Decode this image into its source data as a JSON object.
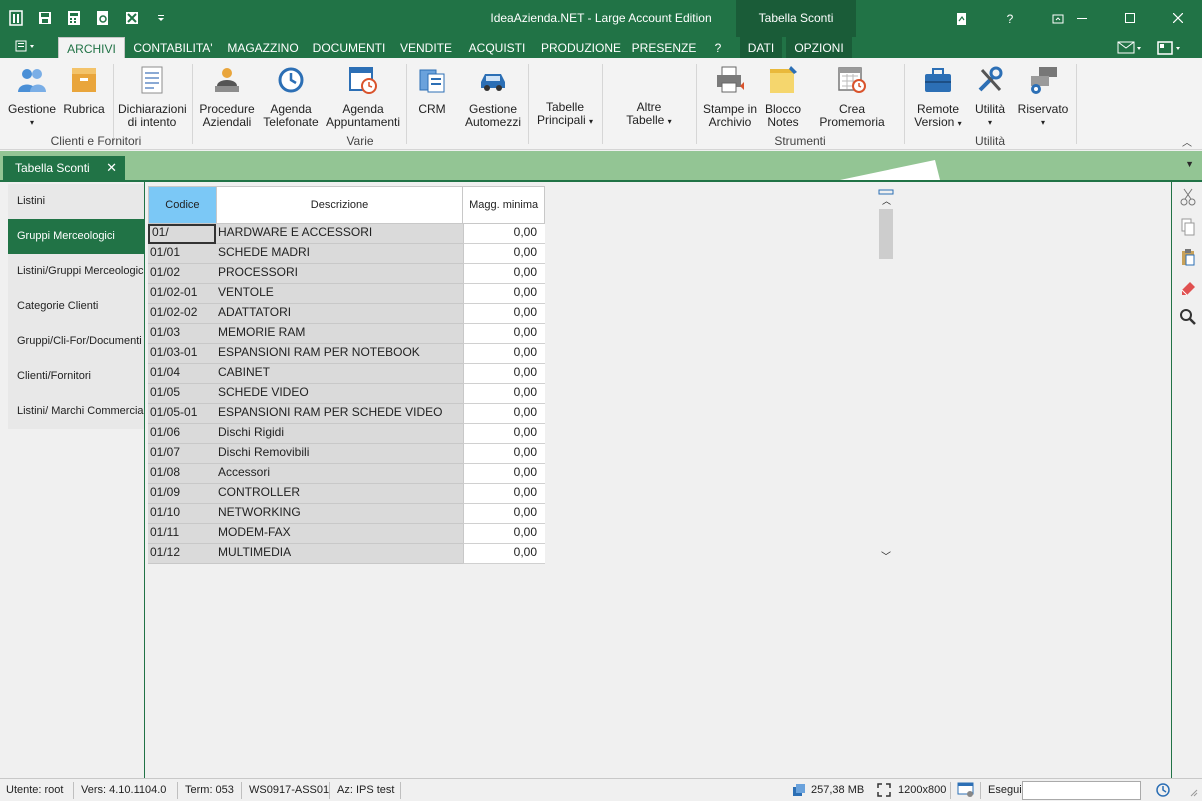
{
  "window": {
    "title": "IdeaAzienda.NET - Large Account Edition",
    "context_title": "Tabella Sconti",
    "help_label": "?"
  },
  "tabs": [
    {
      "label": "ARCHIVI",
      "active": true
    },
    {
      "label": "CONTABILITA'"
    },
    {
      "label": "MAGAZZINO"
    },
    {
      "label": "DOCUMENTI"
    },
    {
      "label": "VENDITE"
    },
    {
      "label": "ACQUISTI"
    },
    {
      "label": "PRODUZIONE"
    },
    {
      "label": "PRESENZE"
    },
    {
      "label": "?"
    },
    {
      "label": "DATI"
    },
    {
      "label": "OPZIONI"
    }
  ],
  "ribbon": {
    "gestione": "Gestione",
    "rubrica": "Rubrica",
    "dichiarazioni_1": "Dichiarazioni",
    "dichiarazioni_2": "di intento",
    "group_clienti": "Clienti e Fornitori",
    "procedure_1": "Procedure",
    "procedure_2": "Aziendali",
    "agenda_tel_1": "Agenda",
    "agenda_tel_2": "Telefonate",
    "agenda_app_1": "Agenda",
    "agenda_app_2": "Appuntamenti",
    "group_varie": "Varie",
    "crm": "CRM",
    "automezzi_1": "Gestione",
    "automezzi_2": "Automezzi",
    "tabelle_1": "Tabelle",
    "tabelle_2": "Principali",
    "altre_1": "Altre",
    "altre_2": "Tabelle",
    "stampe_1": "Stampe in",
    "stampe_2": "Archivio",
    "blocco_1": "Blocco",
    "blocco_2": "Notes",
    "promemoria": "Crea Promemoria",
    "group_strumenti": "Strumenti",
    "remote_1": "Remote",
    "remote_2": "Version",
    "utilita": "Utilità",
    "riservato": "Riservato",
    "group_utilita": "Utilità"
  },
  "doc_tab": {
    "label": "Tabella Sconti",
    "close": "✕"
  },
  "nav": [
    "Listini",
    "Gruppi Merceologici",
    "Listini/Gruppi Merceologici",
    "Categorie Clienti",
    "Gruppi/Cli-For/Documenti",
    "Clienti/Fornitori",
    "Listini/ Marchi Commerciali"
  ],
  "grid": {
    "headers": {
      "codice": "Codice",
      "descrizione": "Descrizione",
      "magg": "Magg. minima"
    },
    "rows": [
      {
        "codice": "01/",
        "descrizione": "HARDWARE E ACCESSORI",
        "magg": "0,00"
      },
      {
        "codice": "01/01",
        "descrizione": "SCHEDE MADRI",
        "magg": "0,00"
      },
      {
        "codice": "01/02",
        "descrizione": "PROCESSORI",
        "magg": "0,00"
      },
      {
        "codice": "01/02-01",
        "descrizione": "VENTOLE",
        "magg": "0,00"
      },
      {
        "codice": "01/02-02",
        "descrizione": "ADATTATORI",
        "magg": "0,00"
      },
      {
        "codice": "01/03",
        "descrizione": "MEMORIE RAM",
        "magg": "0,00"
      },
      {
        "codice": "01/03-01",
        "descrizione": "ESPANSIONI RAM PER NOTEBOOK",
        "magg": "0,00"
      },
      {
        "codice": "01/04",
        "descrizione": "CABINET",
        "magg": "0,00"
      },
      {
        "codice": "01/05",
        "descrizione": "SCHEDE VIDEO",
        "magg": "0,00"
      },
      {
        "codice": "01/05-01",
        "descrizione": "ESPANSIONI RAM PER SCHEDE VIDEO",
        "magg": "0,00"
      },
      {
        "codice": "01/06",
        "descrizione": "Dischi Rigidi",
        "magg": "0,00"
      },
      {
        "codice": "01/07",
        "descrizione": "Dischi Removibili",
        "magg": "0,00"
      },
      {
        "codice": "01/08",
        "descrizione": "Accessori",
        "magg": "0,00"
      },
      {
        "codice": "01/09",
        "descrizione": "CONTROLLER",
        "magg": "0,00"
      },
      {
        "codice": "01/10",
        "descrizione": "NETWORKING",
        "magg": "0,00"
      },
      {
        "codice": "01/11",
        "descrizione": "MODEM-FAX",
        "magg": "0,00"
      },
      {
        "codice": "01/12",
        "descrizione": "MULTIMEDIA",
        "magg": "0,00"
      }
    ]
  },
  "status": {
    "utente": "Utente: root",
    "vers": "Vers: 4.10.1104.0",
    "term": "Term: 053",
    "ws": "WS0917-ASS01",
    "az": "Az: IPS test",
    "mem": "257,38 MB",
    "res": "1200x800",
    "esegui": "Esegui"
  },
  "colors": {
    "accent": "#217346",
    "header_selected": "#7bc8f6",
    "strip": "#93c594"
  }
}
